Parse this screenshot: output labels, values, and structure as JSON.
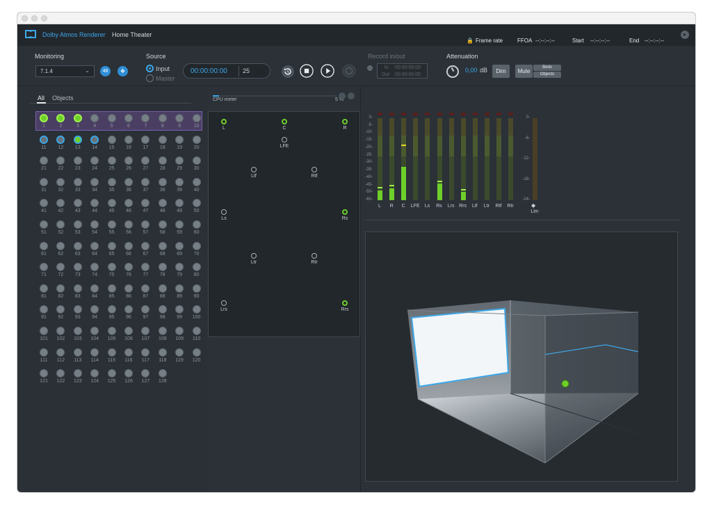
{
  "app": {
    "name": "Dolby Atmos Renderer",
    "subtitle": "Home Theater",
    "frame_rate_label": "Frame rate",
    "ffoa_label": "FFOA",
    "ffoa_value": "--:--:--:--",
    "start_label": "Start",
    "start_value": "--:--:--:--",
    "end_label": "End",
    "end_value": "--:--:--:--"
  },
  "monitoring": {
    "label": "Monitoring",
    "selected": "7.1.4",
    "badge": "48"
  },
  "source": {
    "label": "Source",
    "options": [
      {
        "label": "Input",
        "selected": true
      },
      {
        "label": "Master",
        "selected": false
      }
    ]
  },
  "transport": {
    "timecode": "00:00:00:00",
    "fps": "25"
  },
  "record": {
    "label": "Record in/out",
    "in_label": "In",
    "in_value": "00:00:00:00",
    "out_label": "Out",
    "out_value": "00:00:00:00"
  },
  "attenuation": {
    "label": "Attenuation",
    "value": "0,00",
    "unit": "dB",
    "dim_label": "Dim",
    "mute_label": "Mute",
    "beds_label": "Beds",
    "objects_label": "Objects"
  },
  "tabs": [
    "All",
    "Objects"
  ],
  "channels": {
    "count": 128,
    "active": [
      1,
      2,
      3,
      13
    ],
    "ringed": [
      11,
      12,
      13,
      14
    ],
    "bed_range": [
      1,
      10
    ]
  },
  "cpu": {
    "label": "CPU meter",
    "percent_text": "5 %",
    "percent": 5
  },
  "speakers": [
    {
      "name": "L",
      "active": true
    },
    {
      "name": "C",
      "active": true
    },
    {
      "name": "R",
      "active": true
    },
    {
      "name": "LFE",
      "active": false
    },
    {
      "name": "Ltf",
      "active": false
    },
    {
      "name": "Rtf",
      "active": false
    },
    {
      "name": "Ls",
      "active": false
    },
    {
      "name": "Rs",
      "active": true
    },
    {
      "name": "Ltr",
      "active": false
    },
    {
      "name": "Rtr",
      "active": false
    },
    {
      "name": "Lrs",
      "active": false
    },
    {
      "name": "Rrs",
      "active": true
    }
  ],
  "meters": {
    "scale": [
      "0-",
      "-5-",
      "-10-",
      "-15-",
      "-20-",
      "-25-",
      "-30-",
      "-35-",
      "-40-",
      "-45-",
      "-50-",
      "-60-"
    ],
    "lim_scale": [
      "0-",
      "-6-",
      "-12-",
      "-18-",
      "-24-"
    ],
    "lim_label": "Lim",
    "channels": [
      {
        "name": "L",
        "level": 0.12,
        "peak": 0.14
      },
      {
        "name": "R",
        "level": 0.14,
        "peak": 0.17
      },
      {
        "name": "C",
        "level": 0.41,
        "peak": 0.66
      },
      {
        "name": "LFE",
        "level": 0,
        "peak": 0
      },
      {
        "name": "Ls",
        "level": 0,
        "peak": 0
      },
      {
        "name": "Rs",
        "level": 0.2,
        "peak": 0.22
      },
      {
        "name": "Lrs",
        "level": 0,
        "peak": 0
      },
      {
        "name": "Rrs",
        "level": 0.1,
        "peak": 0.12
      },
      {
        "name": "Ltf",
        "level": 0,
        "peak": 0
      },
      {
        "name": "Ltr",
        "level": 0,
        "peak": 0
      },
      {
        "name": "Rtf",
        "level": 0,
        "peak": 0
      },
      {
        "name": "Rtr",
        "level": 0,
        "peak": 0
      }
    ]
  },
  "colors": {
    "accent": "#3da6e8",
    "active": "#6fcf2a",
    "bed_highlight": "#4a3e63"
  }
}
